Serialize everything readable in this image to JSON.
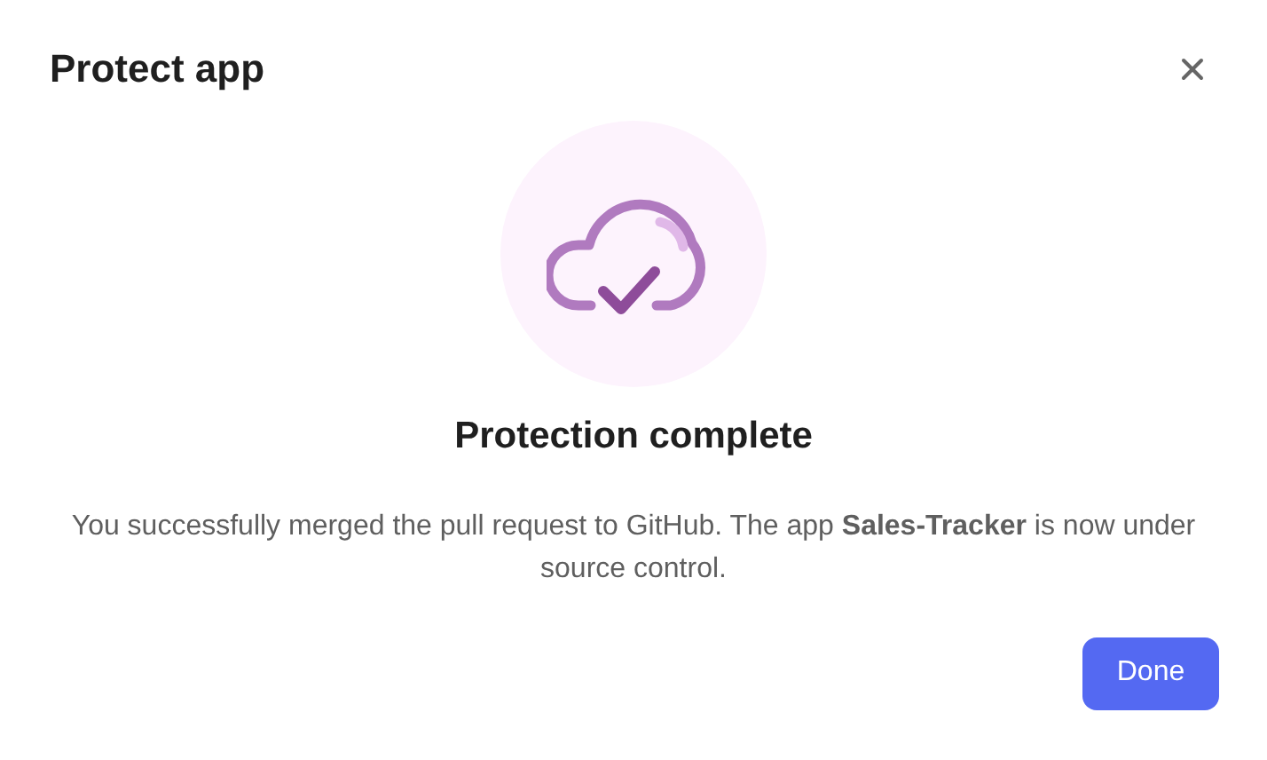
{
  "dialog": {
    "title": "Protect app",
    "heading": "Protection complete",
    "message": "You successfully merged the pull request to GitHub. The app **Sales-Tracker** is now under source control.",
    "buttons": [
      "Done"
    ]
  }
}
